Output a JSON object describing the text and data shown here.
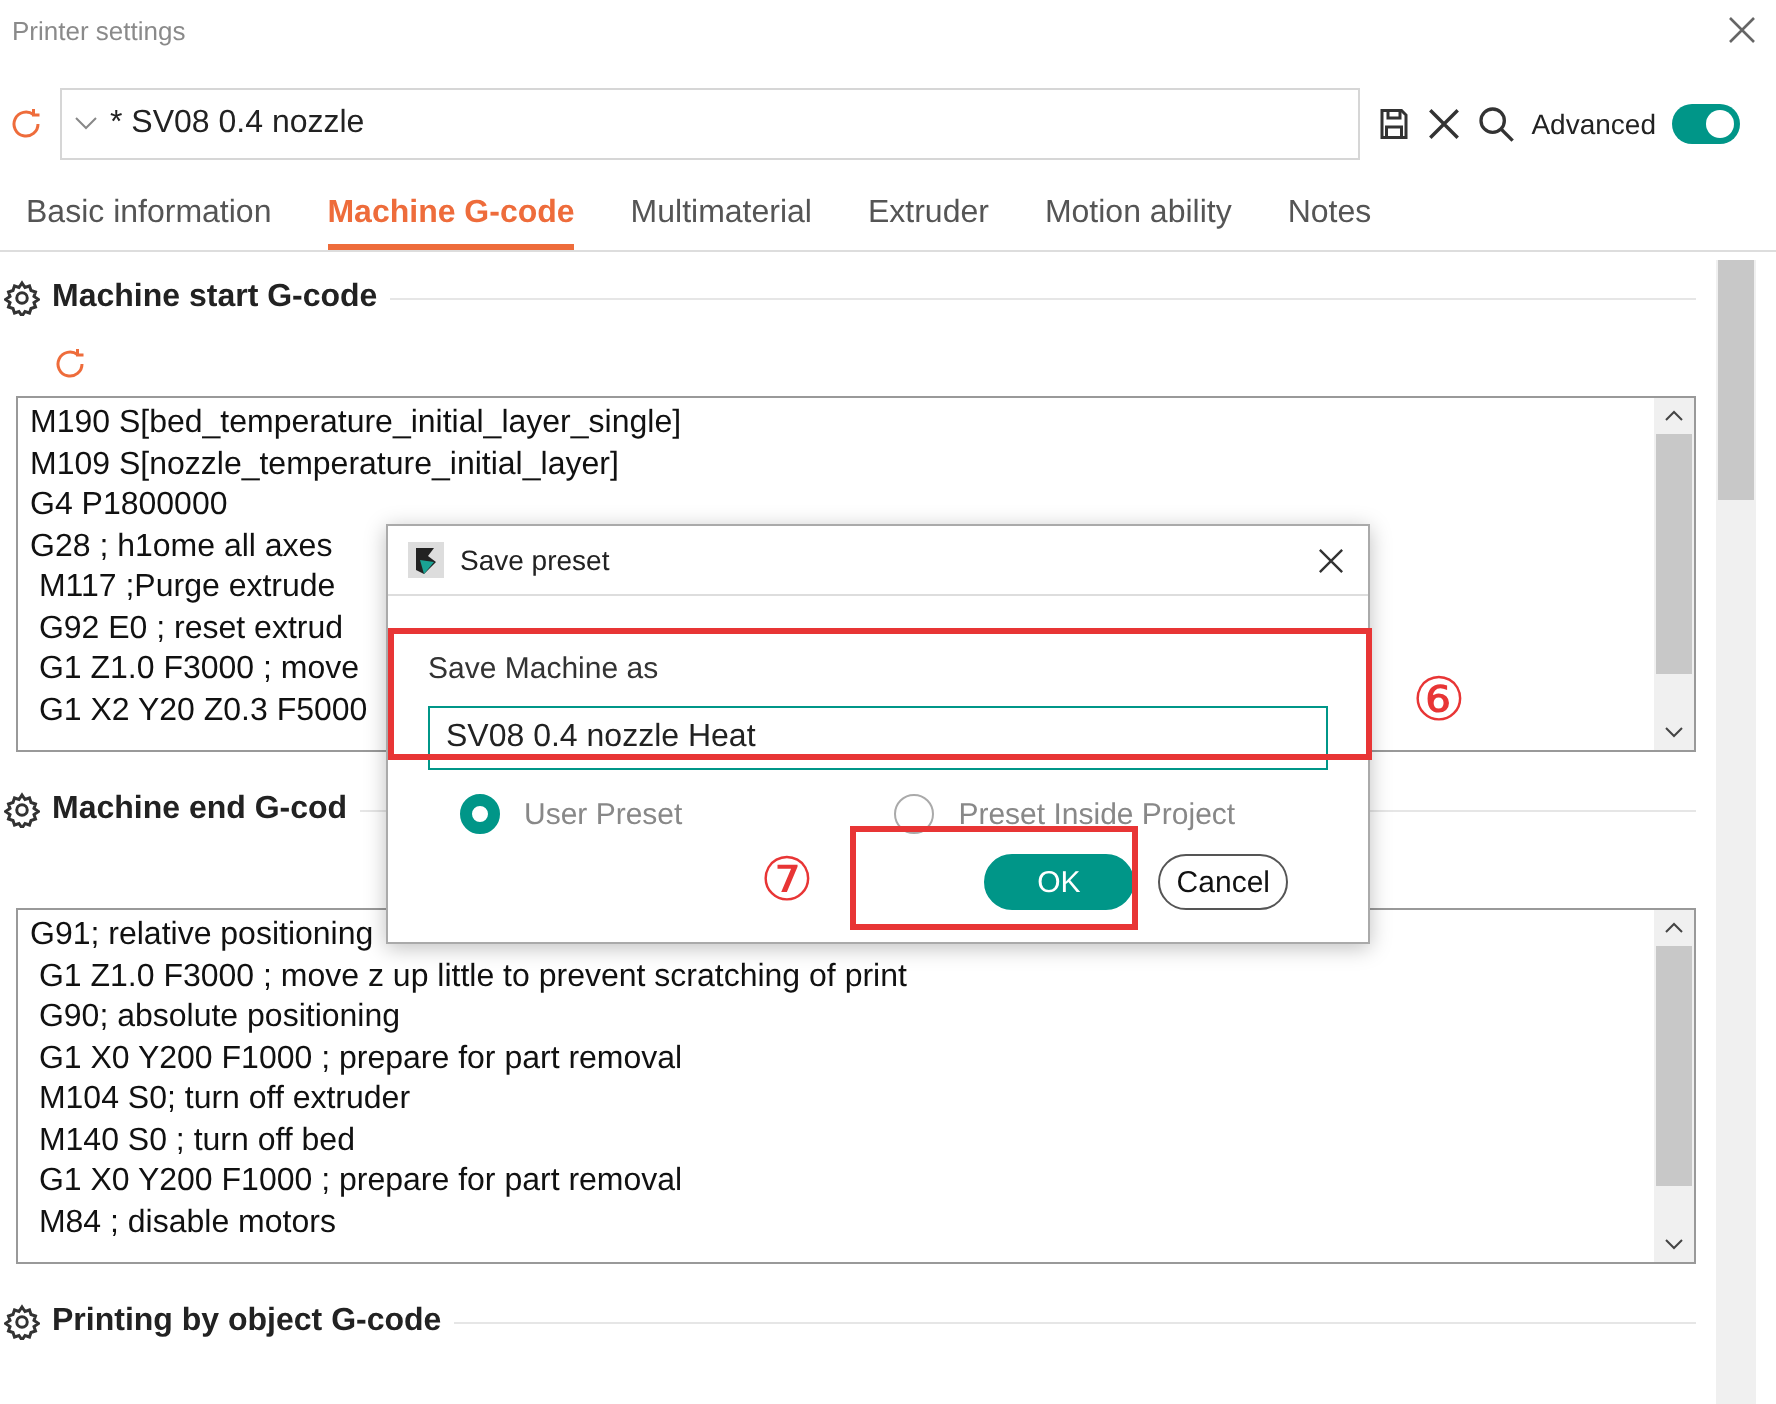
{
  "window": {
    "title": "Printer settings"
  },
  "toolbar": {
    "preset": "* SV08 0.4 nozzle",
    "advanced_label": "Advanced",
    "advanced_on": true
  },
  "tabs": [
    {
      "label": "Basic information",
      "selected": false
    },
    {
      "label": "Machine G-code",
      "selected": true
    },
    {
      "label": "Multimaterial",
      "selected": false
    },
    {
      "label": "Extruder",
      "selected": false
    },
    {
      "label": "Motion ability",
      "selected": false
    },
    {
      "label": "Notes",
      "selected": false
    }
  ],
  "sections": [
    {
      "title": "Machine start G-code",
      "reset": true,
      "lines": [
        "M190 S[bed_temperature_initial_layer_single]",
        "M109 S[nozzle_temperature_initial_layer]",
        "G4 P1800000",
        "G28 ; h1ome all axes",
        " M117 ;Purge extrude",
        " G92 E0 ; reset extrud",
        " G1 Z1.0 F3000 ; move",
        " G1 X2 Y20 Z0.3 F5000"
      ]
    },
    {
      "title": "Machine end G-cod",
      "reset": false,
      "lines": [
        "G91; relative positioning",
        " G1 Z1.0 F3000 ; move z up little to prevent scratching of print",
        " G90; absolute positioning",
        " G1 X0 Y200 F1000 ; prepare for part removal",
        " M104 S0; turn off extruder",
        " M140 S0 ; turn off bed",
        " G1 X0 Y200 F1000 ; prepare for part removal",
        " M84 ; disable motors"
      ]
    },
    {
      "title": "Printing by object G-code"
    }
  ],
  "dialog": {
    "title": "Save preset",
    "label": "Save Machine as",
    "value": "SV08 0.4 nozzle Heat",
    "options": [
      {
        "label": "User Preset",
        "selected": true
      },
      {
        "label": "Preset Inside Project",
        "selected": false
      }
    ],
    "buttons": [
      {
        "label": "OK",
        "kind": "primary"
      },
      {
        "label": "Cancel",
        "kind": "secondary"
      }
    ]
  },
  "callouts": [
    "⑥",
    "⑦"
  ]
}
